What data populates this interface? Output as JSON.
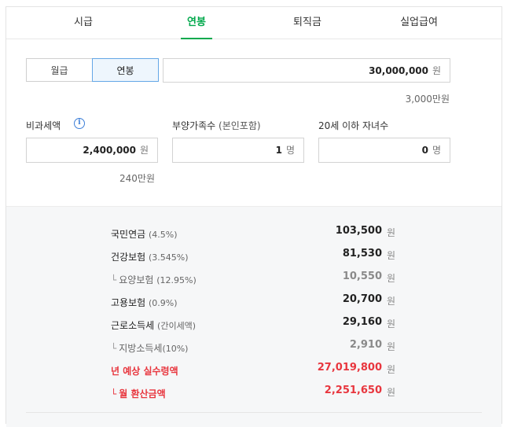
{
  "tabs": [
    {
      "label": "시급",
      "active": false
    },
    {
      "label": "연봉",
      "active": true
    },
    {
      "label": "퇴직금",
      "active": false
    },
    {
      "label": "실업급여",
      "active": false
    }
  ],
  "pay_type": {
    "monthly": "월급",
    "annual": "연봉",
    "selected": "연봉"
  },
  "salary": {
    "value": "30,000,000",
    "unit": "원",
    "korean": "3,000만원"
  },
  "nontaxable": {
    "label": "비과세액",
    "value": "2,400,000",
    "unit": "원",
    "korean": "240만원"
  },
  "dependents": {
    "label": "부양가족수",
    "note": "(본인포함)",
    "value": "1",
    "unit": "명"
  },
  "children": {
    "label": "20세 이하 자녀수",
    "value": "0",
    "unit": "명"
  },
  "results": [
    {
      "name": "국민연금",
      "pct": "(4.5%)",
      "amount": "103,500",
      "unit": "원"
    },
    {
      "name": "건강보험",
      "pct": "(3.545%)",
      "amount": "81,530",
      "unit": "원"
    },
    {
      "name": "요양보험",
      "pct": "(12.95%)",
      "amount": "10,550",
      "unit": "원"
    },
    {
      "name": "고용보험",
      "pct": "(0.9%)",
      "amount": "20,700",
      "unit": "원"
    },
    {
      "name": "근로소득세",
      "pct": "(간이세액)",
      "amount": "29,160",
      "unit": "원"
    },
    {
      "name": "지방소득세",
      "pct": "(10%)",
      "amount": "2,910",
      "unit": "원"
    },
    {
      "name": "년 예상 실수령액",
      "pct": "",
      "amount": "27,019,800",
      "unit": "원"
    },
    {
      "name": "월 환산금액",
      "pct": "",
      "amount": "2,251,650",
      "unit": "원"
    }
  ],
  "colors": {
    "accent": "#03a94d",
    "highlight": "#e8363e",
    "selected_border": "#64a7e6"
  }
}
